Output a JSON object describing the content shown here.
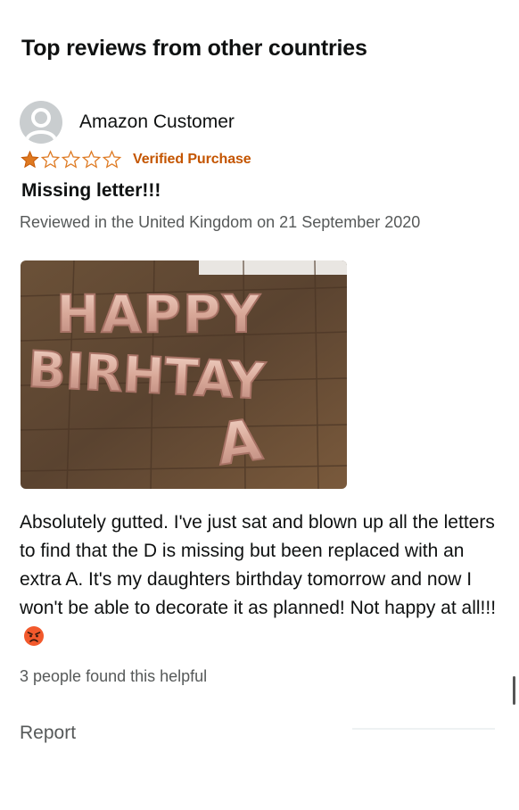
{
  "section": {
    "title": "Top reviews from other countries"
  },
  "review": {
    "reviewer_name": "Amazon Customer",
    "rating": 1,
    "rating_max": 5,
    "verified_label": "Verified Purchase",
    "title": "Missing letter!!!",
    "date_text": "Reviewed in the United Kingdom on 21 September 2020",
    "body": "Absolutely gutted. I've just sat and blown up all the letters to find that the D is missing but been replaced with an extra A. It's my daughters birthday tomorrow and now I won't be able to decorate it as planned! Not happy at all!!!",
    "body_emoji": "angry-face-icon",
    "helpful_text": "3 people found this helpful",
    "report_label": "Report",
    "image": {
      "line1": "HAPPY",
      "line2": "BIRHTAY",
      "line3": "A"
    }
  },
  "colors": {
    "star": "#de7921",
    "verified": "#c45500",
    "secondary_text": "#565959",
    "primary_text": "#0f1111",
    "avatar_bg": "#c9cdcf",
    "balloon": "#d8a898",
    "floor": "#5a4330"
  }
}
